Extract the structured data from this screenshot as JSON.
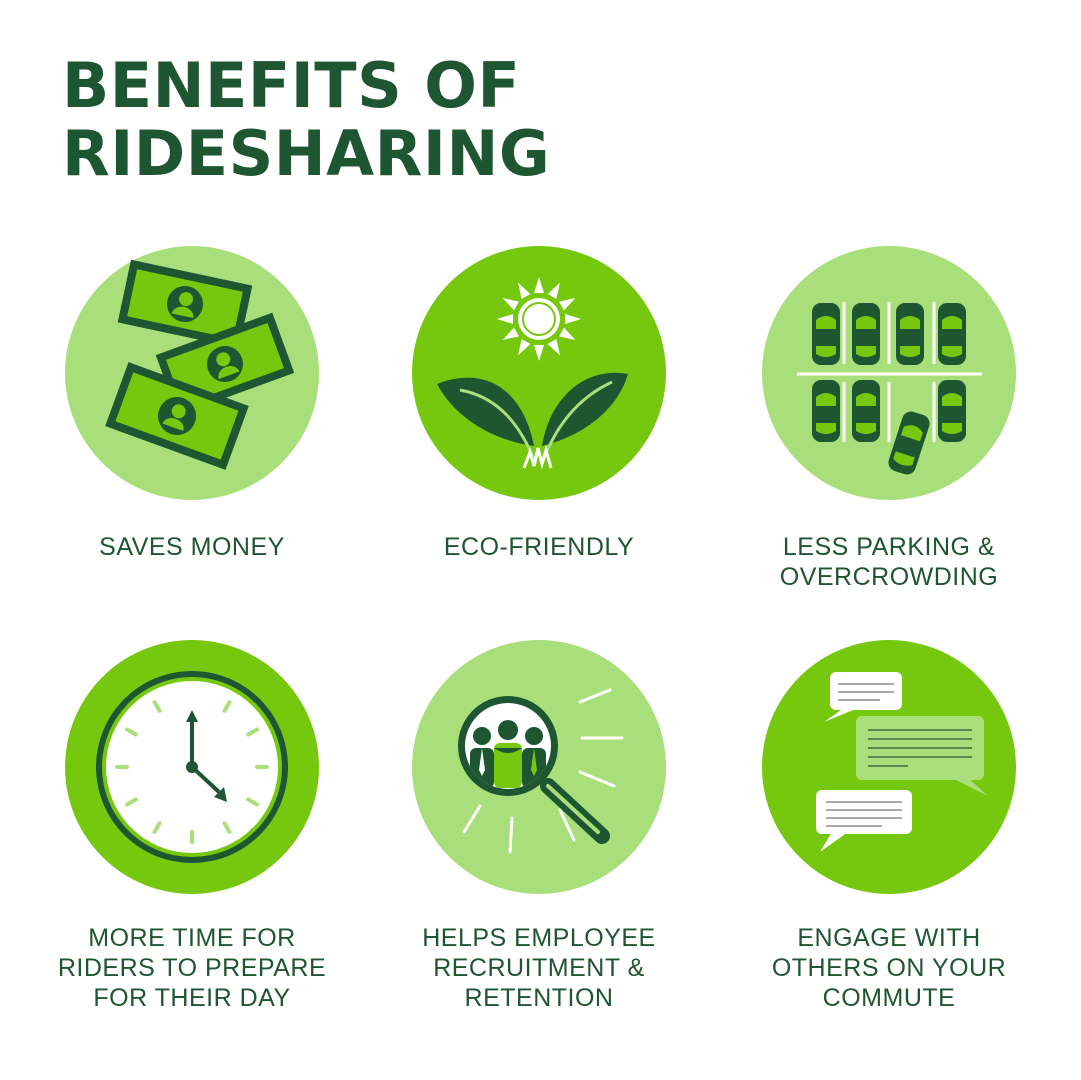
{
  "title": {
    "line1": "BENEFITS OF",
    "line2": "RIDESHARING"
  },
  "colors": {
    "dark_green": "#1e5631",
    "bright_green": "#76c80e",
    "light_green": "#a8df7a",
    "white": "#ffffff"
  },
  "benefits": [
    {
      "icon": "money-icon",
      "lines": [
        "SAVES MONEY"
      ]
    },
    {
      "icon": "plant-sun-icon",
      "lines": [
        "ECO-FRIENDLY"
      ]
    },
    {
      "icon": "parking-lot-icon",
      "lines": [
        "LESS PARKING &",
        "OVERCROWDING"
      ]
    },
    {
      "icon": "clock-icon",
      "lines": [
        "MORE TIME FOR",
        "RIDERS TO PREPARE",
        "FOR THEIR DAY"
      ]
    },
    {
      "icon": "recruitment-magnifier-icon",
      "lines": [
        "HELPS EMPLOYEE",
        "RECRUITMENT &",
        "RETENTION"
      ]
    },
    {
      "icon": "chat-bubbles-icon",
      "lines": [
        "ENGAGE WITH",
        "OTHERS ON YOUR",
        "COMMUTE"
      ]
    }
  ]
}
